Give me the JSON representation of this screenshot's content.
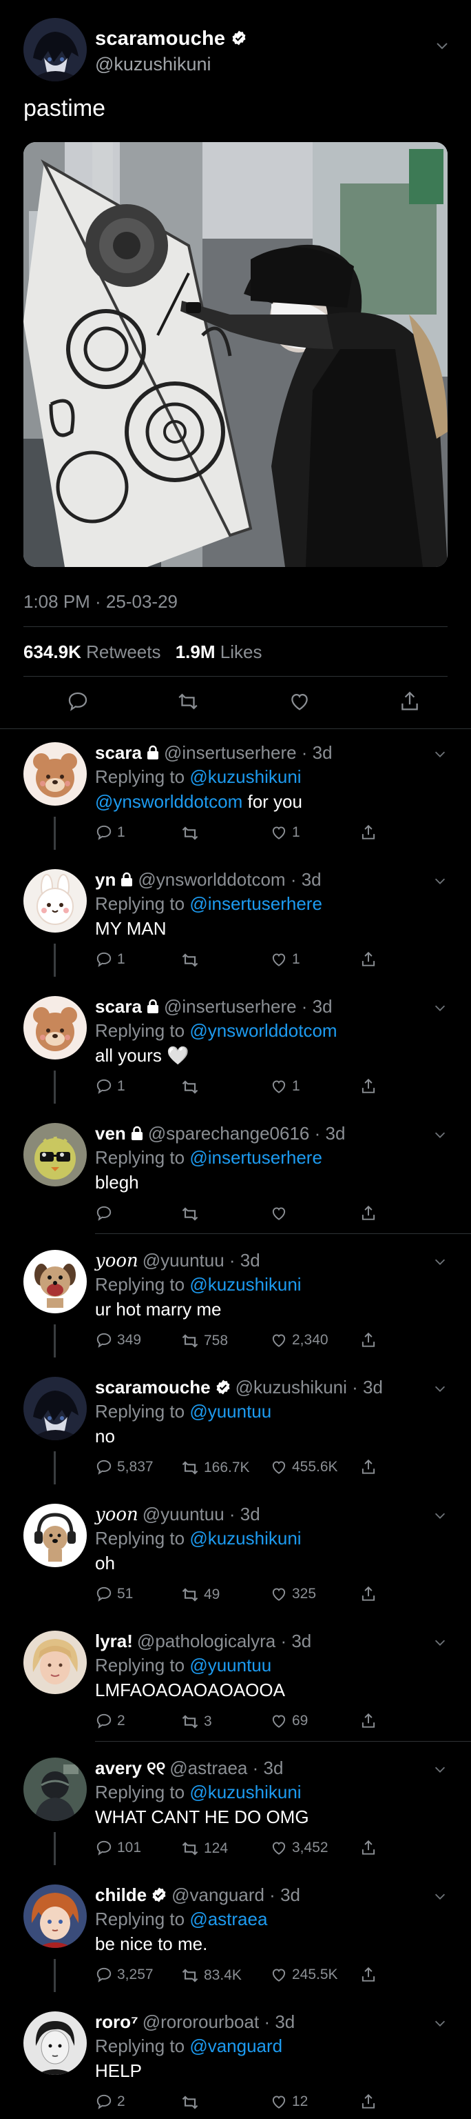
{
  "colors": {
    "background": "#000000",
    "text": "#ffffff",
    "muted": "#8b8f94",
    "link": "#1d9bf0",
    "divider": "#2f3336"
  },
  "main_tweet": {
    "name": "scaramouche",
    "handle": "@kuzushikuni",
    "verified": true,
    "text": "pastime",
    "timestamp": "1:08 PM · 25-03-29",
    "retweets_count": "634.9K",
    "retweets_label": "Retweets",
    "likes_count": "1.9M",
    "likes_label": "Likes",
    "icons": [
      "comment-icon",
      "retweet-icon",
      "heart-icon",
      "share-icon"
    ]
  },
  "replies": [
    {
      "name": "scara",
      "locked": true,
      "verified": false,
      "handle": "@insertuserhere",
      "time": "3d",
      "replying_label": "Replying to",
      "replying_to": "@kuzushikuni",
      "mention": "@ynsworlddotcom",
      "text": " for you",
      "replies": "1",
      "retweets": "",
      "likes": "1",
      "avatar": "brown-bear"
    },
    {
      "name": "yn",
      "locked": true,
      "verified": false,
      "handle": "@ynsworlddotcom",
      "time": "3d",
      "replying_label": "Replying to",
      "replying_to": "@insertuserhere",
      "mention": "",
      "text": "MY MAN",
      "replies": "1",
      "retweets": "",
      "likes": "1",
      "avatar": "white-bunny"
    },
    {
      "name": "scara",
      "locked": true,
      "verified": false,
      "handle": "@insertuserhere",
      "time": "3d",
      "replying_label": "Replying to",
      "replying_to": "@ynsworlddotcom",
      "mention": "",
      "text": "all yours 🤍",
      "replies": "1",
      "retweets": "",
      "likes": "1",
      "avatar": "brown-bear"
    },
    {
      "name": "ven",
      "locked": true,
      "verified": false,
      "handle": "@sparechange0616",
      "time": "3d",
      "replying_label": "Replying to",
      "replying_to": "@insertuserhere",
      "mention": "",
      "text": "blegh",
      "replies": "",
      "retweets": "",
      "likes": "",
      "avatar": "green-bird"
    },
    {
      "name": "yoon",
      "locked": false,
      "verified": false,
      "script": true,
      "handle": "@yuuntuu",
      "time": "3d",
      "replying_label": "Replying to",
      "replying_to": "@kuzushikuni",
      "mention": "",
      "text": "ur hot marry me",
      "replies": "349",
      "retweets": "758",
      "likes": "2,340",
      "avatar": "dog-photo"
    },
    {
      "name": "scaramouche",
      "locked": false,
      "verified": true,
      "handle": "@kuzushikuni",
      "time": "3d",
      "replying_label": "Replying to",
      "replying_to": "@yuuntuu",
      "mention": "",
      "text": "no",
      "replies": "5,837",
      "retweets": "166.7K",
      "likes": "455.6K",
      "avatar": "dark-anime"
    },
    {
      "name": "yoon",
      "locked": false,
      "verified": false,
      "script": true,
      "handle": "@yuuntuu",
      "time": "3d",
      "replying_label": "Replying to",
      "replying_to": "@kuzushikuni",
      "mention": "",
      "text": "oh",
      "replies": "51",
      "retweets": "49",
      "likes": "325",
      "avatar": "dog-headphones"
    },
    {
      "name": "lyra!",
      "locked": false,
      "verified": false,
      "handle": "@pathologicalyra",
      "time": "3d",
      "replying_label": "Replying to",
      "replying_to": "@yuuntuu",
      "mention": "",
      "text": "LMFAOAOAOAOAOOA",
      "replies": "2",
      "retweets": "3",
      "likes": "69",
      "avatar": "blonde-person"
    },
    {
      "name": "avery ୧୧",
      "locked": false,
      "verified": false,
      "handle": "@astraea",
      "time": "3d",
      "replying_label": "Replying to",
      "replying_to": "@kuzushikuni",
      "mention": "",
      "text": "WHAT CANT HE DO OMG",
      "replies": "101",
      "retweets": "124",
      "likes": "3,452",
      "avatar": "dark-figure"
    },
    {
      "name": "childe",
      "locked": false,
      "verified": true,
      "handle": "@vanguard",
      "time": "3d",
      "replying_label": "Replying to",
      "replying_to": "@astraea",
      "mention": "",
      "text": "be nice to me.",
      "replies": "3,257",
      "retweets": "83.4K",
      "likes": "245.5K",
      "avatar": "orange-anime"
    },
    {
      "name": "roro⁷",
      "locked": false,
      "verified": false,
      "handle": "@rororourboat",
      "time": "3d",
      "replying_label": "Replying to",
      "replying_to": "@vanguard",
      "mention": "",
      "text": "HELP",
      "replies": "2",
      "retweets": "",
      "likes": "12",
      "avatar": "bw-portrait"
    }
  ]
}
